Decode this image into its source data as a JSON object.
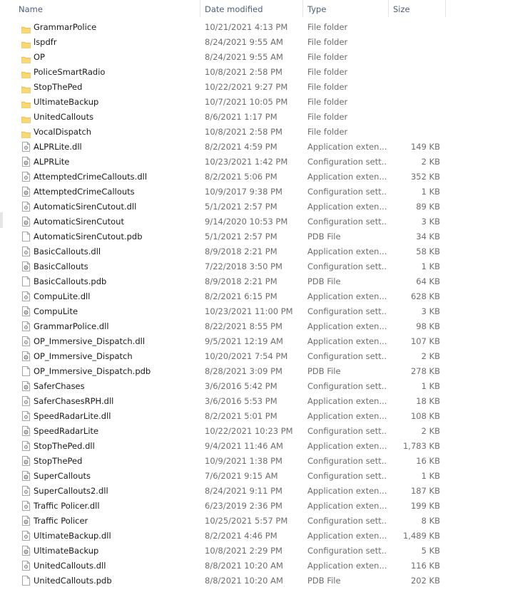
{
  "columns": {
    "name": "Name",
    "date": "Date modified",
    "type": "Type",
    "size": "Size"
  },
  "sort_indicator": "^",
  "colors": {
    "folder": "#f8d775",
    "folder_dark": "#e8b94a",
    "header_text": "#4c607a"
  },
  "files": [
    {
      "name": "GrammarPolice",
      "date": "10/21/2021 4:13 PM",
      "type": "File folder",
      "size": "",
      "icon": "folder-icon"
    },
    {
      "name": "lspdfr",
      "date": "8/24/2021 9:55 AM",
      "type": "File folder",
      "size": "",
      "icon": "folder-icon"
    },
    {
      "name": "OP",
      "date": "8/24/2021 9:55 AM",
      "type": "File folder",
      "size": "",
      "icon": "folder-icon"
    },
    {
      "name": "PoliceSmartRadio",
      "date": "10/8/2021 2:58 PM",
      "type": "File folder",
      "size": "",
      "icon": "folder-icon"
    },
    {
      "name": "StopThePed",
      "date": "10/22/2021 9:27 PM",
      "type": "File folder",
      "size": "",
      "icon": "folder-icon"
    },
    {
      "name": "UltimateBackup",
      "date": "10/7/2021 10:05 PM",
      "type": "File folder",
      "size": "",
      "icon": "folder-icon"
    },
    {
      "name": "UnitedCallouts",
      "date": "8/6/2021 1:17 PM",
      "type": "File folder",
      "size": "",
      "icon": "folder-icon"
    },
    {
      "name": "VocalDispatch",
      "date": "10/8/2021 2:58 PM",
      "type": "File folder",
      "size": "",
      "icon": "folder-icon"
    },
    {
      "name": "ALPRLite.dll",
      "date": "8/2/2021 4:59 PM",
      "type": "Application exten...",
      "size": "149 KB",
      "icon": "dll-file-icon"
    },
    {
      "name": "ALPRLite",
      "date": "10/23/2021 1:42 PM",
      "type": "Configuration sett...",
      "size": "2 KB",
      "icon": "config-file-icon"
    },
    {
      "name": "AttemptedCrimeCallouts.dll",
      "date": "8/2/2021 5:06 PM",
      "type": "Application exten...",
      "size": "352 KB",
      "icon": "dll-file-icon"
    },
    {
      "name": "AttemptedCrimeCallouts",
      "date": "10/9/2017 9:38 PM",
      "type": "Configuration sett...",
      "size": "1 KB",
      "icon": "config-file-icon"
    },
    {
      "name": "AutomaticSirenCutout.dll",
      "date": "5/1/2021 2:57 PM",
      "type": "Application exten...",
      "size": "89 KB",
      "icon": "dll-file-icon"
    },
    {
      "name": "AutomaticSirenCutout",
      "date": "9/14/2020 10:53 PM",
      "type": "Configuration sett...",
      "size": "3 KB",
      "icon": "config-file-icon"
    },
    {
      "name": "AutomaticSirenCutout.pdb",
      "date": "5/1/2021 2:57 PM",
      "type": "PDB File",
      "size": "34 KB",
      "icon": "blank-file-icon"
    },
    {
      "name": "BasicCallouts.dll",
      "date": "8/9/2018 2:21 PM",
      "type": "Application exten...",
      "size": "58 KB",
      "icon": "dll-file-icon"
    },
    {
      "name": "BasicCallouts",
      "date": "7/22/2018 3:50 PM",
      "type": "Configuration sett...",
      "size": "1 KB",
      "icon": "config-file-icon"
    },
    {
      "name": "BasicCallouts.pdb",
      "date": "8/9/2018 2:21 PM",
      "type": "PDB File",
      "size": "64 KB",
      "icon": "blank-file-icon"
    },
    {
      "name": "CompuLite.dll",
      "date": "8/2/2021 6:15 PM",
      "type": "Application exten...",
      "size": "628 KB",
      "icon": "dll-file-icon"
    },
    {
      "name": "CompuLite",
      "date": "10/23/2021 11:00 PM",
      "type": "Configuration sett...",
      "size": "3 KB",
      "icon": "config-file-icon"
    },
    {
      "name": "GrammarPolice.dll",
      "date": "8/22/2021 8:55 PM",
      "type": "Application exten...",
      "size": "98 KB",
      "icon": "dll-file-icon"
    },
    {
      "name": "OP_Immersive_Dispatch.dll",
      "date": "9/5/2021 12:19 AM",
      "type": "Application exten...",
      "size": "107 KB",
      "icon": "dll-file-icon"
    },
    {
      "name": "OP_Immersive_Dispatch",
      "date": "10/20/2021 7:54 PM",
      "type": "Configuration sett...",
      "size": "2 KB",
      "icon": "config-file-icon"
    },
    {
      "name": "OP_Immersive_Dispatch.pdb",
      "date": "8/28/2021 3:09 PM",
      "type": "PDB File",
      "size": "278 KB",
      "icon": "blank-file-icon"
    },
    {
      "name": "SaferChases",
      "date": "3/6/2016 5:42 PM",
      "type": "Configuration sett...",
      "size": "1 KB",
      "icon": "config-file-icon"
    },
    {
      "name": "SaferChasesRPH.dll",
      "date": "3/6/2016 5:53 PM",
      "type": "Application exten...",
      "size": "18 KB",
      "icon": "dll-file-icon"
    },
    {
      "name": "SpeedRadarLite.dll",
      "date": "8/2/2021 5:01 PM",
      "type": "Application exten...",
      "size": "108 KB",
      "icon": "dll-file-icon"
    },
    {
      "name": "SpeedRadarLite",
      "date": "10/22/2021 10:23 PM",
      "type": "Configuration sett...",
      "size": "2 KB",
      "icon": "config-file-icon"
    },
    {
      "name": "StopThePed.dll",
      "date": "9/4/2021 11:46 AM",
      "type": "Application exten...",
      "size": "1,783 KB",
      "icon": "dll-file-icon"
    },
    {
      "name": "StopThePed",
      "date": "10/9/2021 1:38 PM",
      "type": "Configuration sett...",
      "size": "16 KB",
      "icon": "config-file-icon"
    },
    {
      "name": "SuperCallouts",
      "date": "7/6/2021 9:15 AM",
      "type": "Configuration sett...",
      "size": "1 KB",
      "icon": "config-file-icon"
    },
    {
      "name": "SuperCallouts2.dll",
      "date": "8/24/2021 9:11 PM",
      "type": "Application exten...",
      "size": "187 KB",
      "icon": "dll-file-icon"
    },
    {
      "name": "Traffic Policer.dll",
      "date": "6/23/2019 2:36 PM",
      "type": "Application exten...",
      "size": "199 KB",
      "icon": "dll-file-icon"
    },
    {
      "name": "Traffic Policer",
      "date": "10/25/2021 5:57 PM",
      "type": "Configuration sett...",
      "size": "8 KB",
      "icon": "config-file-icon"
    },
    {
      "name": "UltimateBackup.dll",
      "date": "8/2/2021 4:46 PM",
      "type": "Application exten...",
      "size": "1,489 KB",
      "icon": "dll-file-icon"
    },
    {
      "name": "UltimateBackup",
      "date": "10/8/2021 2:29 PM",
      "type": "Configuration sett...",
      "size": "5 KB",
      "icon": "config-file-icon"
    },
    {
      "name": "UnitedCallouts.dll",
      "date": "8/8/2021 10:20 AM",
      "type": "Application exten...",
      "size": "116 KB",
      "icon": "dll-file-icon"
    },
    {
      "name": "UnitedCallouts.pdb",
      "date": "8/8/2021 10:20 AM",
      "type": "PDB File",
      "size": "202 KB",
      "icon": "blank-file-icon"
    }
  ]
}
